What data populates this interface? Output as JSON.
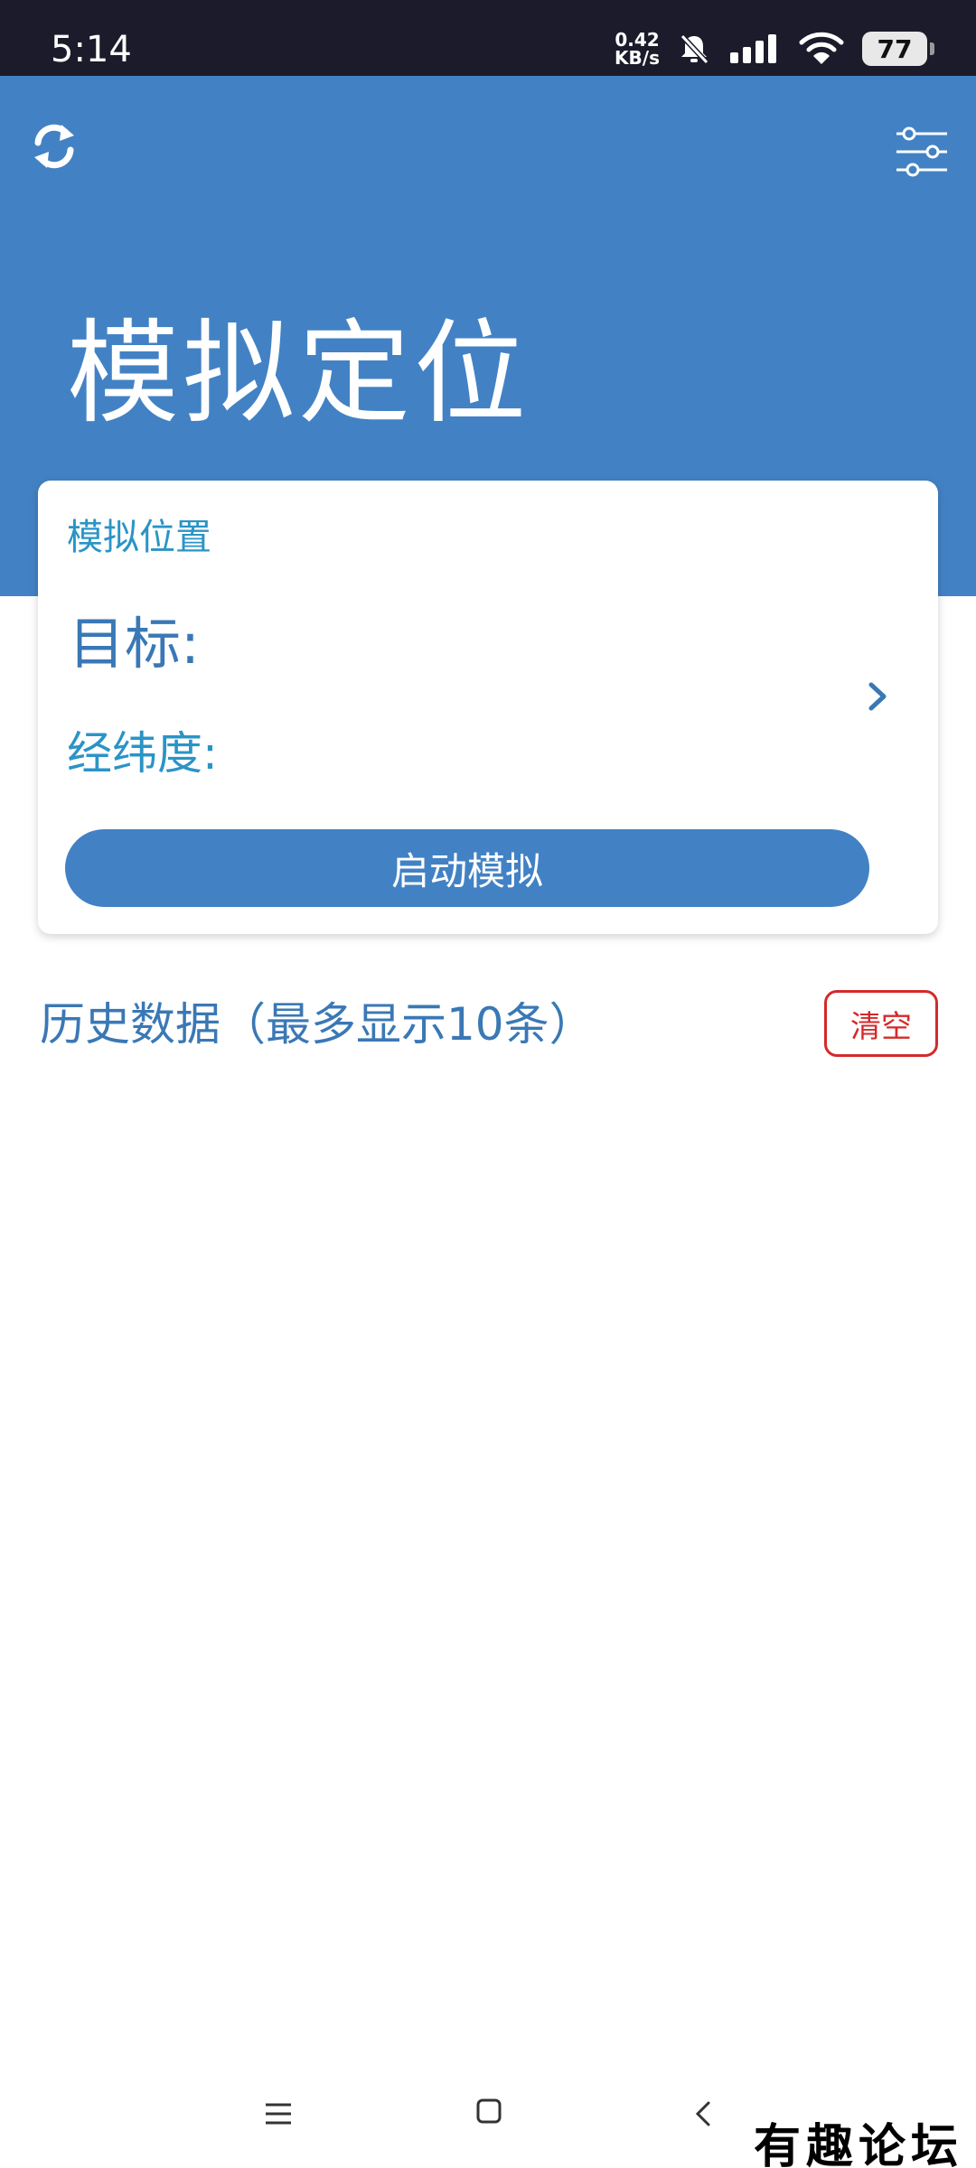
{
  "status_bar": {
    "time": "5:14",
    "net_speed_value": "0.42",
    "net_speed_unit": "KB/s",
    "battery": "77"
  },
  "header": {
    "title": "模拟定位",
    "refresh_icon": "refresh-icon",
    "settings_icon": "sliders-icon",
    "color": "#4282c4"
  },
  "card": {
    "section_label": "模拟位置",
    "target_label": "目标:",
    "coord_label": "经纬度:",
    "start_button": "启动模拟"
  },
  "history": {
    "title": "历史数据（最多显示10条）",
    "clear_button": "清空"
  },
  "watermark": "有趣论坛"
}
